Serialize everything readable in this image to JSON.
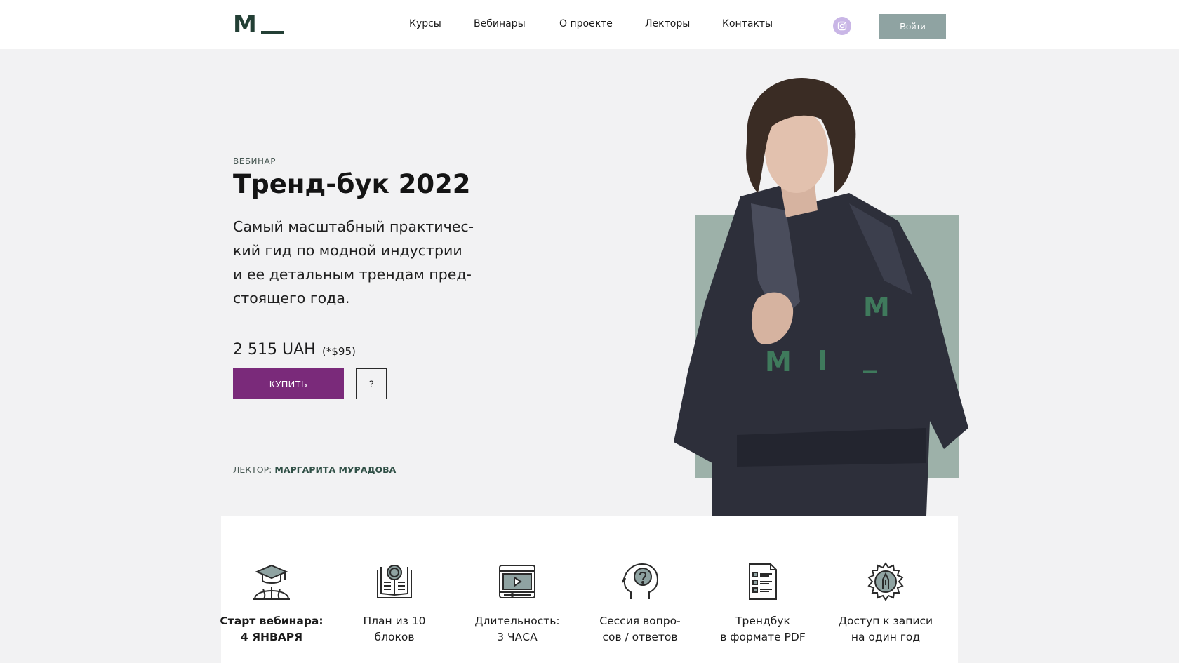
{
  "header": {
    "logo_letter": "M",
    "nav": [
      "Курсы",
      "Вебинары",
      "О проекте",
      "Лекторы",
      "Контакты"
    ],
    "instagram_icon": "instagram-icon",
    "login_label": "Войти"
  },
  "hero": {
    "kicker": "ВЕБИНАР",
    "title": "Тренд-бук 2022",
    "description_lines": [
      "Самый масштабный практичес-",
      "кий гид по модной индустрии",
      "и ее детальным трендам пред-",
      "стоящего года."
    ],
    "price": "2 515 UAH",
    "price_usd": "(*$95)",
    "buy_label": "КУПИТЬ",
    "help_label": "?",
    "lector_label": "ЛЕКТОР:",
    "lector_name": "МАРГАРИТА МУРАДОВА",
    "image_overlay_letters": [
      "M",
      "M",
      "I",
      "_"
    ]
  },
  "features": [
    {
      "icon": "graduation-globe-icon",
      "line1": "Старт вебинара:",
      "line2": "4 ЯНВАРЯ",
      "bold": true
    },
    {
      "icon": "book-search-icon",
      "line1": "План из 10",
      "line2": "блоков",
      "bold": false
    },
    {
      "icon": "video-player-icon",
      "line1": "Длительность:",
      "line2": "3 ЧАСА",
      "bold": false
    },
    {
      "icon": "head-question-icon",
      "line1": "Сессия вопро-",
      "line2": "сов / ответов",
      "bold": false
    },
    {
      "icon": "document-list-icon",
      "line1": "Трендбук",
      "line2": "в формате PDF",
      "bold": false
    },
    {
      "icon": "gear-pen-icon",
      "line1": "Доступ к записи",
      "line2": "на один год",
      "bold": false
    }
  ],
  "colors": {
    "accent_purple": "#7a2a7a",
    "brand_green": "#233f35",
    "sage": "#9db1a9",
    "login_gray": "#8fa3a2"
  }
}
